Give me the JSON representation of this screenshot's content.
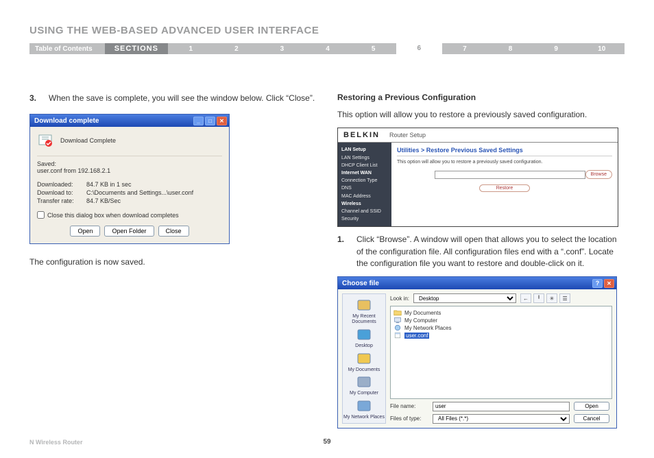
{
  "page": {
    "title": "USING THE WEB-BASED ADVANCED USER INTERFACE",
    "footer_product": "N Wireless Router",
    "page_number": "59"
  },
  "nav": {
    "toc_label": "Table of Contents",
    "sections_label": "SECTIONS",
    "numbers": [
      "1",
      "2",
      "3",
      "4",
      "5",
      "6",
      "7",
      "8",
      "9",
      "10"
    ],
    "active_index": 5
  },
  "left": {
    "step_num": "3.",
    "step_text": "When the save is complete, you will see the window below. Click “Close”.",
    "config_saved": "The configuration is now saved."
  },
  "download_dialog": {
    "title": "Download complete",
    "heading": "Download Complete",
    "saved_label": "Saved:",
    "saved_file": "user.conf from 192.168.2.1",
    "rows": [
      {
        "label": "Downloaded:",
        "value": "84.7 KB in 1 sec"
      },
      {
        "label": "Download to:",
        "value": "C:\\Documents and Settings...\\user.conf"
      },
      {
        "label": "Transfer rate:",
        "value": "84.7 KB/Sec"
      }
    ],
    "close_checkbox": "Close this dialog box when download completes",
    "buttons": {
      "open": "Open",
      "open_folder": "Open Folder",
      "close": "Close"
    }
  },
  "right": {
    "heading": "Restoring a Previous Configuration",
    "intro": "This option will allow you to restore a previously saved configuration.",
    "step_num": "1.",
    "step_text": "Click “Browse”. A window will open that allows you to select the location of the configuration file. All configuration files end with a “.conf”. Locate the configuration file you want to restore and double-click on it."
  },
  "router_panel": {
    "logo": "BELKIN",
    "subtitle": "Router Setup",
    "breadcrumb": "Utilities > Restore Previous Saved Settings",
    "note": "This option will allow you to restore a previously saved configuration.",
    "browse": "Browse",
    "restore": "Restore",
    "sidebar": [
      {
        "text": "LAN Setup",
        "hd": true
      },
      {
        "text": "LAN Settings"
      },
      {
        "text": "DHCP Client List"
      },
      {
        "text": "Internet WAN",
        "hd": true
      },
      {
        "text": "Connection Type"
      },
      {
        "text": "DNS"
      },
      {
        "text": "MAC Address"
      },
      {
        "text": "Wireless",
        "hd": true
      },
      {
        "text": "Channel and SSID"
      },
      {
        "text": "Security"
      }
    ]
  },
  "choose_file": {
    "title": "Choose file",
    "look_in_label": "Look in:",
    "look_in_value": "Desktop",
    "side_items": [
      {
        "label": "My Recent Documents",
        "icon": "recent"
      },
      {
        "label": "Desktop",
        "icon": "desktop"
      },
      {
        "label": "My Documents",
        "icon": "mydocs"
      },
      {
        "label": "My Computer",
        "icon": "computer"
      },
      {
        "label": "My Network Places",
        "icon": "network"
      }
    ],
    "list_items": [
      {
        "name": "My Documents",
        "type": "folder",
        "selected": false
      },
      {
        "name": "My Computer",
        "type": "computer",
        "selected": false
      },
      {
        "name": "My Network Places",
        "type": "network",
        "selected": false
      },
      {
        "name": "user.conf",
        "type": "file",
        "selected": true
      }
    ],
    "filename_label": "File name:",
    "filename_value": "user",
    "filetype_label": "Files of type:",
    "filetype_value": "All Files (*.*)",
    "open": "Open",
    "cancel": "Cancel"
  }
}
